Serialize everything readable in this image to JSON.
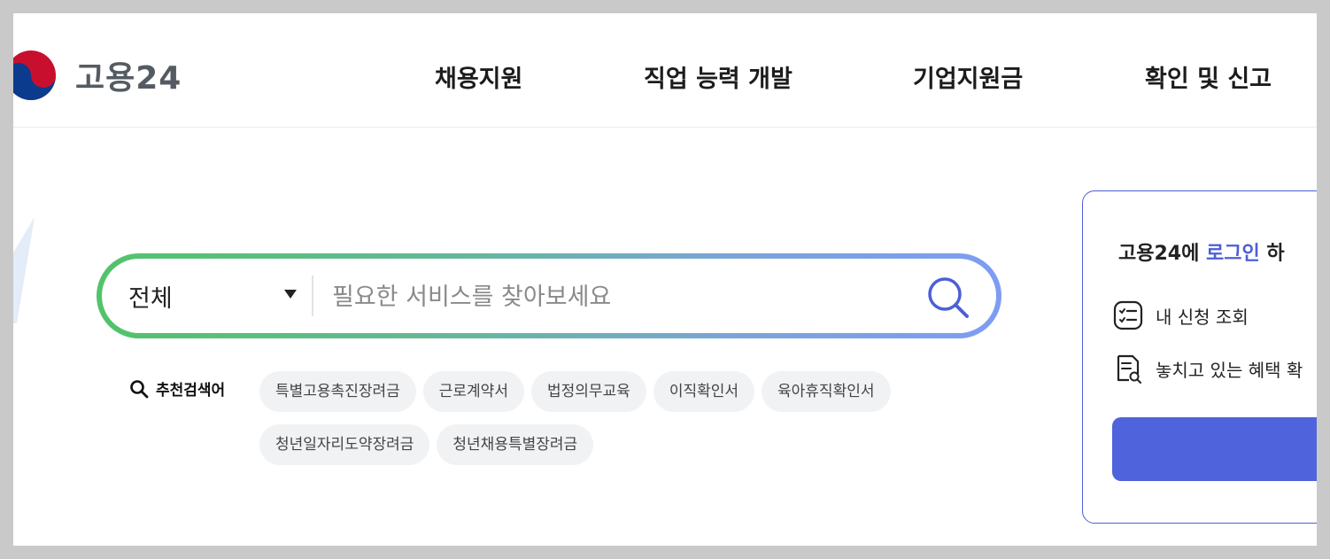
{
  "header": {
    "logo_text": "고용24",
    "nav": [
      "채용지원",
      "직업 능력 개발",
      "기업지원금",
      "확인 및 신고"
    ]
  },
  "search": {
    "category_selected": "전체",
    "placeholder": "필요한 서비스를 찾아보세요",
    "value": ""
  },
  "recommended": {
    "label": "추천검색어",
    "keywords": [
      "특별고용촉진장려금",
      "근로계약서",
      "법정의무교육",
      "이직확인서",
      "육아휴직확인서",
      "청년일자리도약장려금",
      "청년채용특별장려금"
    ]
  },
  "login_card": {
    "title_prefix": "고용24에 ",
    "title_link": "로그인",
    "title_suffix": " 하",
    "items": [
      "내 신청 조회",
      "놓치고 있는 혜택 확"
    ]
  },
  "colors": {
    "accent": "#4f63dd",
    "gradient_start": "#52c36a",
    "gradient_end": "#7f9cf5",
    "chip_bg": "#f1f2f4"
  }
}
